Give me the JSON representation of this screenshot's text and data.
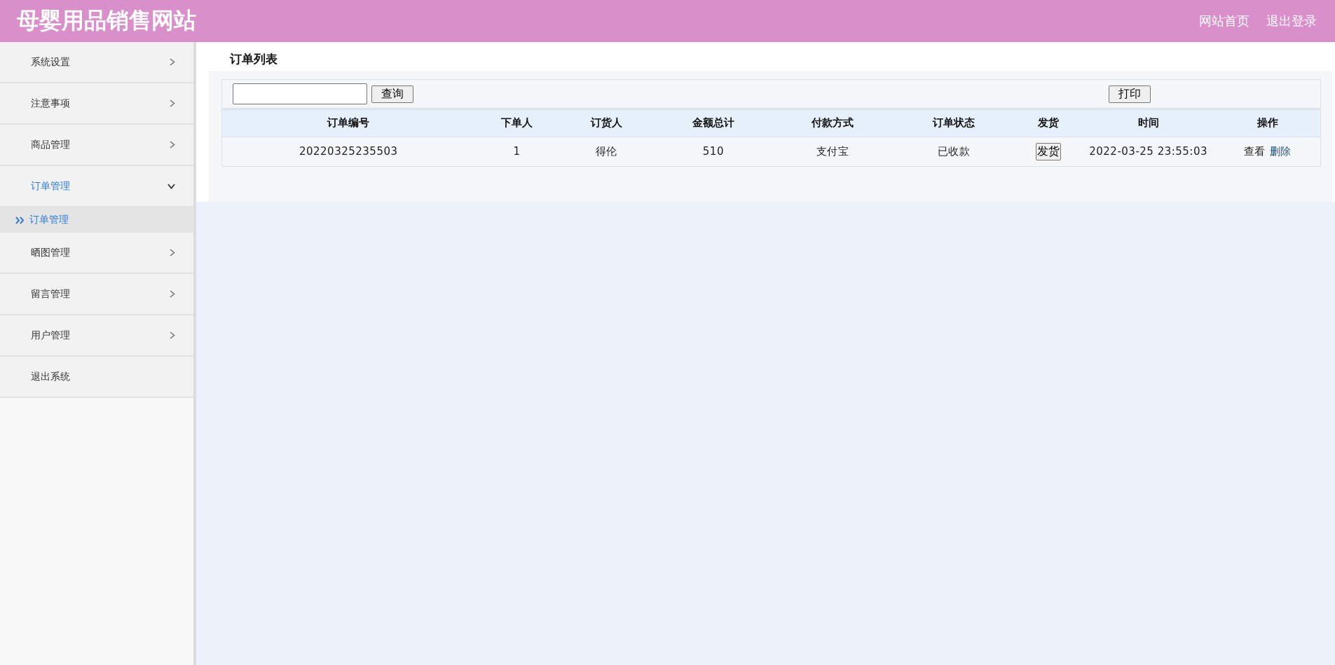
{
  "header": {
    "title": "母婴用品销售网站",
    "links": [
      "网站首页",
      "退出登录"
    ]
  },
  "sidebar": {
    "items": [
      {
        "label": "系统设置",
        "expanded": false,
        "selected": false
      },
      {
        "label": "注意事项",
        "expanded": false,
        "selected": false
      },
      {
        "label": "商品管理",
        "expanded": false,
        "selected": false
      },
      {
        "label": "订单管理",
        "expanded": true,
        "selected": true,
        "children": [
          {
            "label": "订单管理",
            "selected": true
          }
        ]
      },
      {
        "label": "晒图管理",
        "expanded": false,
        "selected": false
      },
      {
        "label": "留言管理",
        "expanded": false,
        "selected": false
      },
      {
        "label": "用户管理",
        "expanded": false,
        "selected": false
      },
      {
        "label": "退出系统",
        "kind": "plain",
        "selected": false
      }
    ]
  },
  "page_title": "订单列表",
  "toolbar": {
    "search_button": "查询",
    "print_button": "打印"
  },
  "table": {
    "columns": [
      "订单编号",
      "下单人",
      "订货人",
      "金额总计",
      "付款方式",
      "订单状态",
      "发货",
      "时间",
      "操作"
    ],
    "rows": [
      {
        "cells": [
          "20220325235503",
          "1",
          "得伦",
          "510",
          "支付宝",
          "已收款"
        ],
        "ship_button": "发货",
        "time": "2022-03-25 23:55:03",
        "actions": [
          "查看",
          "删除"
        ]
      }
    ]
  }
}
